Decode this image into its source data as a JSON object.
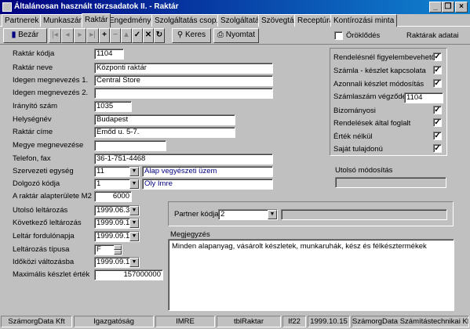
{
  "window": {
    "title": "Általánosan használt törzsadatok II. - Raktár"
  },
  "tabs": [
    "Partnerek",
    "Munkaszám",
    "Raktár",
    "Engedmények",
    "Szolgáltatás csop.",
    "Szolgáltatások",
    "Szövegtár",
    "Receptúra",
    "Kontírozási minta"
  ],
  "toolbar": {
    "close_label": "Bezár",
    "search_label": "Keres",
    "print_label": "Nyomtat",
    "inherit_label": "Öröklődés",
    "header_right": "Raktárak adatai"
  },
  "fields": {
    "code": {
      "label": "Raktár kódja",
      "value": "1104"
    },
    "name": {
      "label": "Raktár neve",
      "value": "Központi raktár"
    },
    "foreign1": {
      "label": "Idegen megnevezés 1.",
      "value": "Central Store"
    },
    "foreign2": {
      "label": "Idegen megnevezés 2.",
      "value": ""
    },
    "zip": {
      "label": "Irányító szám",
      "value": "1035"
    },
    "city": {
      "label": "Helységnév",
      "value": "Budapest"
    },
    "address": {
      "label": "Raktár címe",
      "value": "Emőd u. 5-7."
    },
    "county": {
      "label": "Megye megnevezése",
      "value": ""
    },
    "phone": {
      "label": "Telefon, fax",
      "value": "36-1-751-4468"
    },
    "unit": {
      "label": "Szervezeti egység",
      "value": "11",
      "desc": "Alap vegyészeti üzem"
    },
    "worker": {
      "label": "Dolgozó kódja",
      "value": "1",
      "desc": "Oly Imre"
    },
    "area": {
      "label": "A raktár alapterülete M2",
      "value": "6000"
    },
    "last_inv": {
      "label": "Utolsó leltározás",
      "value": "1999.06.30."
    },
    "next_inv": {
      "label": "Következő leltározás",
      "value": "1999.09.19."
    },
    "inv_turn": {
      "label": "Leltár fordulónapja",
      "value": "1999.09.19."
    },
    "inv_type": {
      "label": "Leltározás típusa",
      "value": "F"
    },
    "period": {
      "label": "Időközi változásba",
      "value": "1999.09.19."
    },
    "max_stock": {
      "label": "Maximális készlet érték",
      "value": "157000000"
    }
  },
  "options": [
    {
      "label": "Rendelésnél figyelembevehető",
      "checked": true
    },
    {
      "label": "Számla - készlet kapcsolata",
      "checked": true
    },
    {
      "label": "Azonnali készlet módosítás",
      "checked": true
    },
    {
      "label": "Számlaszám végződés",
      "checked": false,
      "value": "1104"
    },
    {
      "label": "Bizományosi",
      "checked": true
    },
    {
      "label": "Rendelések által foglalt",
      "checked": true
    },
    {
      "label": "Érték nélkül",
      "checked": true
    },
    {
      "label": "Saját tulajdonú",
      "checked": true
    }
  ],
  "last_modified": {
    "label": "Utolsó módosítás",
    "value": ""
  },
  "partner": {
    "label": "Partner kódja",
    "value": "2",
    "desc": ""
  },
  "note": {
    "label": "Megjegyzés",
    "value": "Minden alapanyag, vásárolt készletek, munkaruhák, kész és félkésztermékek"
  },
  "status": [
    "SzámorgData Kft",
    "Igazgatóság",
    "IMRE",
    "tblRaktar",
    "If22",
    "1999.10.15",
    "SzámorgData Számítástechnikai Kft."
  ],
  "check_mark": "✓"
}
